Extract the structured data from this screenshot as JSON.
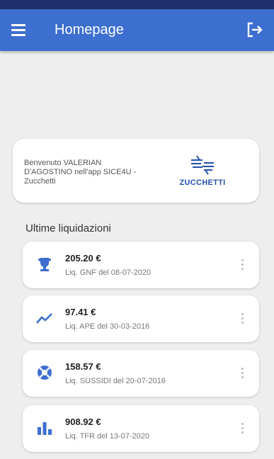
{
  "appbar": {
    "title": "Homepage",
    "color": "#3c6fcf"
  },
  "welcome": {
    "text": "Benvenuto VALERIAN D'AGOSTINO nell'app SICE4U - Zucchetti",
    "logo_text": "ZUCCHETTI"
  },
  "section": {
    "title": "Ultime liquidazioni"
  },
  "liquidazioni": [
    {
      "icon": "trophy-icon",
      "amount": "205.20 €",
      "desc": "Liq. GNF del 08-07-2020"
    },
    {
      "icon": "trending-icon",
      "amount": "97.41 €",
      "desc": "Liq. APE del 30-03-2016"
    },
    {
      "icon": "lifebuoy-icon",
      "amount": "158.57 €",
      "desc": "Liq. SUSSIDI del 20-07-2016"
    },
    {
      "icon": "bar-chart-icon",
      "amount": "908.92 €",
      "desc": "Liq. TFR del 13-07-2020"
    }
  ],
  "icons": {
    "accent": "#3c6fcf"
  }
}
